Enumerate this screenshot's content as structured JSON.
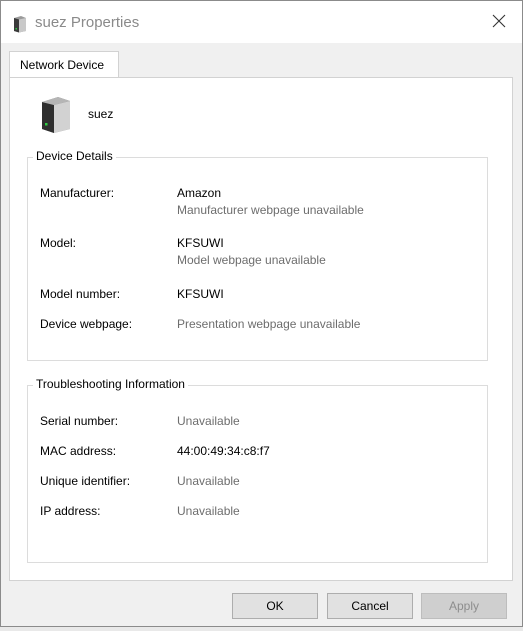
{
  "window": {
    "title": "suez Properties",
    "title_icon": "network-device-icon",
    "close_icon": "close-icon"
  },
  "tabs": [
    {
      "label": "Network Device",
      "active": true
    }
  ],
  "device": {
    "name": "suez",
    "icon": "network-device-icon"
  },
  "device_details": {
    "heading": "Device Details",
    "manufacturer_label": "Manufacturer:",
    "manufacturer_value": "Amazon",
    "manufacturer_link": "Manufacturer webpage unavailable",
    "model_label": "Model:",
    "model_value": "KFSUWI",
    "model_link": "Model webpage unavailable",
    "model_number_label": "Model number:",
    "model_number_value": "KFSUWI",
    "webpage_label": "Device webpage:",
    "webpage_value": "Presentation webpage unavailable"
  },
  "troubleshooting": {
    "heading": "Troubleshooting Information",
    "serial_label": "Serial number:",
    "serial_value": "Unavailable",
    "mac_label": "MAC address:",
    "mac_value": "44:00:49:34:c8:f7",
    "uid_label": "Unique identifier:",
    "uid_value": "Unavailable",
    "ip_label": "IP address:",
    "ip_value": "Unavailable"
  },
  "buttons": {
    "ok": "OK",
    "cancel": "Cancel",
    "apply": "Apply"
  },
  "colors": {
    "accent_blue": "#0a64c8",
    "wallpaper_purple": "#6d2d8c",
    "muted_text": "#6d6d6d"
  }
}
